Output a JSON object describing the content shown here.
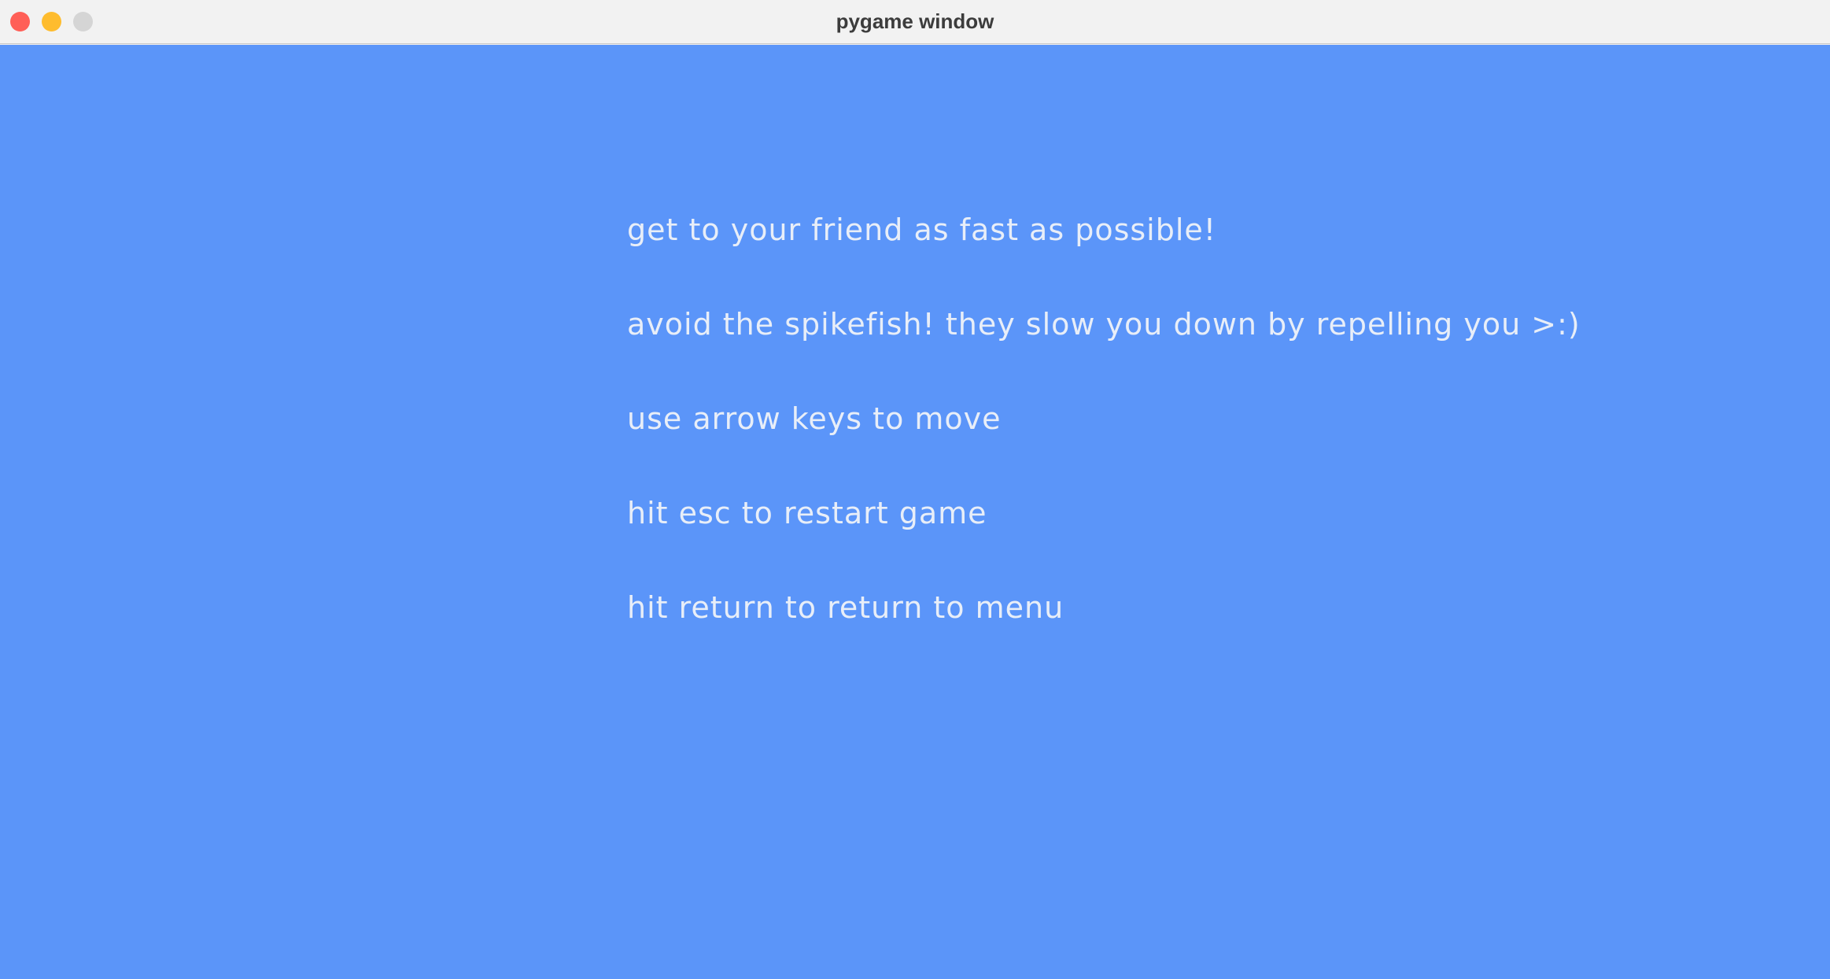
{
  "window": {
    "title": "pygame window",
    "controls": {
      "close_color": "#ff5f57",
      "minimize_color": "#febc2e",
      "zoom_color": "#d5d5d5"
    }
  },
  "game": {
    "background_color": "#5b95f9",
    "text_color": "#e8eef8",
    "instructions": [
      "get to your friend as fast as possible!",
      "avoid the spikefish! they slow you down by repelling you >:)",
      "use arrow keys to move",
      "hit esc to restart game",
      "hit return to return to menu"
    ]
  }
}
